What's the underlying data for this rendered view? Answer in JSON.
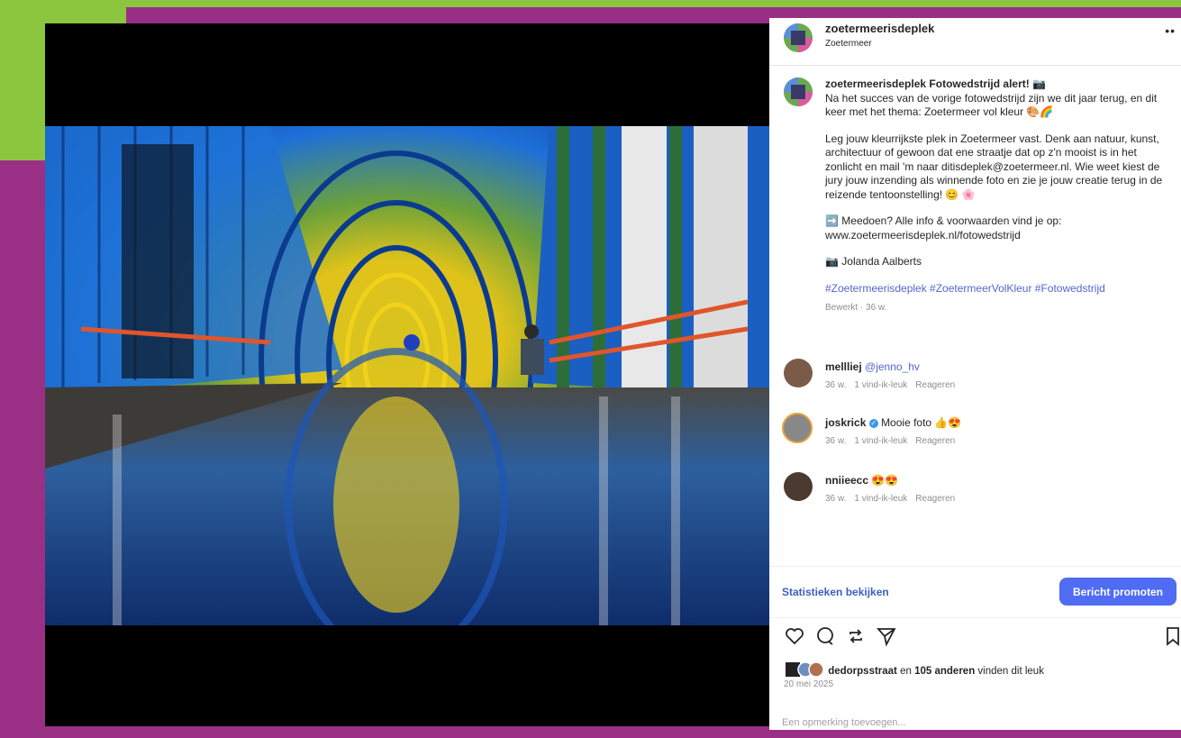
{
  "colors": {
    "frame": "#9a2f86",
    "accent_green": "#8cc63f",
    "link_blue": "#3c5fbf",
    "promote": "#4f6cf3"
  },
  "post": {
    "username": "zoetermeerisdeplek",
    "location": "Zoetermeer",
    "more_icon": "ellipsis-icon",
    "caption": {
      "username": "zoetermeerisdeplek",
      "title": "Fotowedstrijd alert! 📷",
      "p1": "Na het succes van de vorige fotowedstrijd zijn we dit jaar terug, en dit keer met het thema: Zoetermeer vol kleur 🎨🌈",
      "p2": "Leg jouw kleurrijkste plek in Zoetermeer vast. Denk aan natuur, kunst, architectuur of gewoon dat ene straatje dat op z'n mooist is in het zonlicht en mail 'm naar ditisdeplek@zoetermeer.nl. Wie weet kiest de jury jouw inzending als winnende foto en zie je jouw creatie terug in de reizende tentoonstelling! 😊 🌸",
      "p3": "➡️ Meedoen? Alle info & voorwaarden vind je op: www.zoetermeerisdeplek.nl/fotowedstrijd",
      "p4": "📷 Jolanda Aalberts",
      "tags": "#Zoetermeerisdeplek #ZoetermeerVolKleur #Fotowedstrijd",
      "meta": "Bewerkt · 36 w."
    },
    "comments": [
      {
        "user": "mellliej",
        "text": "@jenno_hv",
        "time": "36 w.",
        "likes": "1 vind-ik-leuk",
        "reply": "Reageren"
      },
      {
        "user": "joskrick",
        "text": "Mooie foto 👍😍",
        "time": "36 w.",
        "likes": "1 vind-ik-leuk",
        "reply": "Reageren"
      },
      {
        "user": "nniieecc",
        "text": "😍😍",
        "time": "36 w.",
        "likes": "1 vind-ik-leuk",
        "reply": "Reageren"
      }
    ],
    "stats_link": "Statistieken bekijken",
    "promote_button": "Bericht promoten",
    "actions": [
      "heart-icon",
      "comment-icon",
      "repost-icon",
      "share-icon",
      "bookmark-icon"
    ],
    "likes": {
      "user": "dedorpsstraat",
      "connector": "en",
      "others": "105 anderen",
      "suffix": "vinden dit leuk"
    },
    "date": "20 mei 2025",
    "add_comment_placeholder": "Een opmerking toevoegen..."
  }
}
